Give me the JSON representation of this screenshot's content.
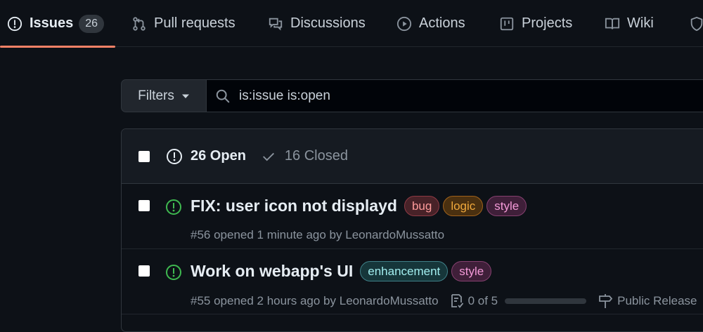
{
  "nav": {
    "tabs": [
      {
        "label": "Issues",
        "count": "26",
        "icon": "issue-opened-icon",
        "selected": true
      },
      {
        "label": "Pull requests",
        "icon": "git-pull-request-icon"
      },
      {
        "label": "Discussions",
        "icon": "comment-discussion-icon"
      },
      {
        "label": "Actions",
        "icon": "play-icon"
      },
      {
        "label": "Projects",
        "icon": "table-icon"
      },
      {
        "label": "Wiki",
        "icon": "book-icon"
      },
      {
        "label": "",
        "icon": "shield-icon"
      }
    ],
    "accent": "#f78166"
  },
  "filter": {
    "button_label": "Filters",
    "search_value": "is:issue is:open"
  },
  "issues": {
    "open_label": "26 Open",
    "closed_label": "16 Closed",
    "rows": [
      {
        "title": "FIX: user icon not displayd",
        "labels": [
          "bug",
          "logic",
          "style"
        ],
        "meta": "#56 opened 1 minute ago by ",
        "author": "LeonardoMussatto"
      },
      {
        "title": "Work on webapp's UI",
        "labels": [
          "enhancement",
          "style"
        ],
        "meta": "#55 opened 2 hours ago by ",
        "author": "LeonardoMussatto",
        "tasks": "0 of 5",
        "tasks_progress": 0,
        "milestone": "Public Release"
      }
    ]
  },
  "colors": {
    "background": "#0d1117",
    "open_green": "#3fb950",
    "label_bug": "#ff9b9b",
    "label_logic": "#f0a93c",
    "label_style": "#f49ad8",
    "label_enhancement": "#a2eeef"
  }
}
